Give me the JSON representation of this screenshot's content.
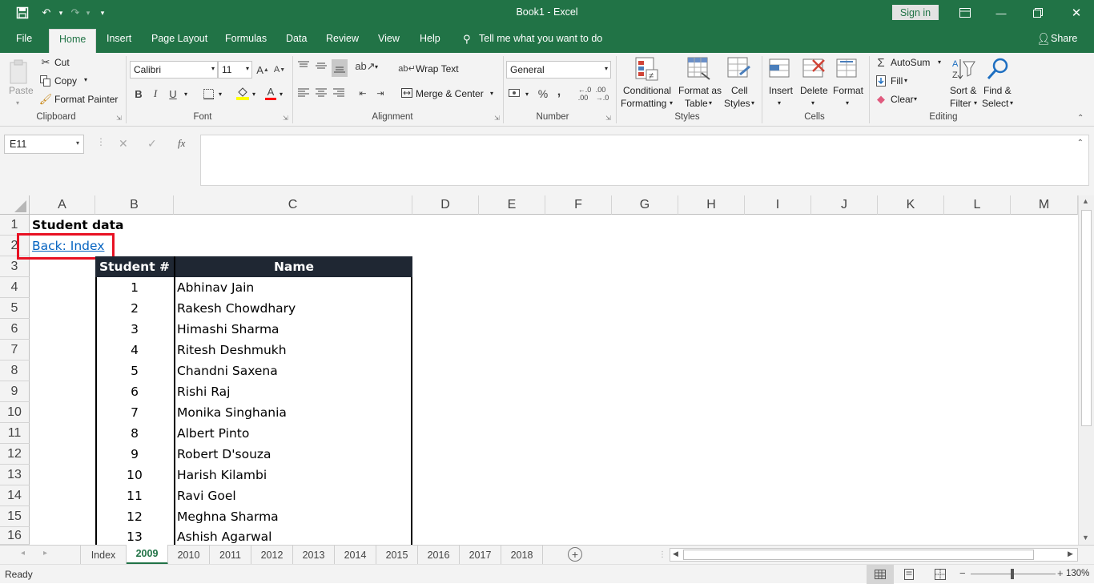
{
  "title": {
    "text": "Book1  -  Excel",
    "sign_in": "Sign in"
  },
  "tabs": [
    "File",
    "Home",
    "Insert",
    "Page Layout",
    "Formulas",
    "Data",
    "Review",
    "View",
    "Help"
  ],
  "tell_me": "Tell me what you want to do",
  "share": "Share",
  "ribbon": {
    "clipboard": {
      "paste": "Paste",
      "cut": "Cut",
      "copy": "Copy",
      "format_painter": "Format Painter",
      "label": "Clipboard"
    },
    "font": {
      "name": "Calibri",
      "size": "11",
      "bold": "B",
      "italic": "I",
      "underline": "U",
      "label": "Font"
    },
    "alignment": {
      "wrap": "Wrap Text",
      "merge": "Merge & Center",
      "label": "Alignment"
    },
    "number": {
      "format": "General",
      "percent": "%",
      "comma": ",",
      "label": "Number"
    },
    "styles": {
      "conditional_1": "Conditional",
      "conditional_2": "Formatting",
      "table_1": "Format as",
      "table_2": "Table",
      "cell_1": "Cell",
      "cell_2": "Styles",
      "label": "Styles"
    },
    "cells": {
      "insert": "Insert",
      "delete": "Delete",
      "format": "Format",
      "label": "Cells"
    },
    "editing": {
      "autosum": "AutoSum",
      "fill": "Fill",
      "clear": "Clear",
      "sort_1": "Sort &",
      "sort_2": "Filter",
      "find_1": "Find &",
      "find_2": "Select",
      "label": "Editing"
    }
  },
  "formula_bar": {
    "name_box": "E11",
    "fx": "fx",
    "content": ""
  },
  "columns": [
    "A",
    "B",
    "C",
    "D",
    "E",
    "F",
    "G",
    "H",
    "I",
    "J",
    "K",
    "L",
    "M"
  ],
  "rows": [
    "1",
    "2",
    "3",
    "4",
    "5",
    "6",
    "7",
    "8",
    "9",
    "10",
    "11",
    "12",
    "13",
    "14",
    "15",
    "16"
  ],
  "sheet": {
    "title": "Student data",
    "link": "Back: Index",
    "header": {
      "num": "Student #",
      "name": "Name"
    },
    "students": [
      {
        "num": "1",
        "name": "Abhinav Jain"
      },
      {
        "num": "2",
        "name": "Rakesh Chowdhary"
      },
      {
        "num": "3",
        "name": "Himashi Sharma"
      },
      {
        "num": "4",
        "name": "Ritesh Deshmukh"
      },
      {
        "num": "5",
        "name": "Chandni Saxena"
      },
      {
        "num": "6",
        "name": "Rishi Raj"
      },
      {
        "num": "7",
        "name": "Monika Singhania"
      },
      {
        "num": "8",
        "name": "Albert Pinto"
      },
      {
        "num": "9",
        "name": "Robert D'souza"
      },
      {
        "num": "10",
        "name": "Harish Kilambi"
      },
      {
        "num": "11",
        "name": "Ravi Goel"
      },
      {
        "num": "12",
        "name": "Meghna Sharma"
      },
      {
        "num": "13",
        "name": "Ashish Agarwal"
      }
    ]
  },
  "sheet_tabs": [
    "Index",
    "2009",
    "2010",
    "2011",
    "2012",
    "2013",
    "2014",
    "2015",
    "2016",
    "2017",
    "2018"
  ],
  "active_sheet": "2009",
  "status": {
    "ready": "Ready",
    "zoom": "130%"
  },
  "colors": {
    "excel_green": "#217346",
    "highlight": "#e81123",
    "link": "#0563c1"
  }
}
